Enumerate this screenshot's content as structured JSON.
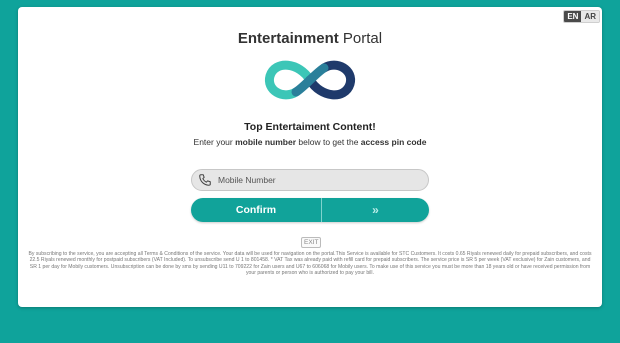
{
  "lang": {
    "en": "EN",
    "ar": "AR"
  },
  "header": {
    "title_bold": "Entertainment",
    "title_rest": " Portal"
  },
  "hero": {
    "headline": "Top Entertaiment Content!",
    "sub_prefix": "Enter your ",
    "sub_bold1": "mobile number",
    "sub_mid": " below to get the ",
    "sub_bold2": "access pin code"
  },
  "form": {
    "mobile_placeholder": "Mobile Number",
    "confirm_label": "Confirm",
    "next_label": "»",
    "exit_label": "EXIT"
  },
  "terms": "By subscribing to the service, you are accepting all Terms & Conditions of the service. Your data will be used for navigation on the portal.This Service is available for STC Customers. It costs 0.65 Riyals renewed daily for prepaid subscribers, and costs 22.5 Riyals renewed monthly for postpaid subscribers (VAT Included). To unsubscribe send U 1 to 801458. * VAT Tax was already paid with refill card for prepaid subscribers. The service price is SR 5 per week (VAT exclusive) for Zain customers, and SR 1 per day for Mobily customers. Unsubscription can be done by sms by sending U11 to 709222 for Zain users and U67 to 606068 for Mobily users. To make use of this service you must be more than 18 years old or have received permission from your parents or person who is authorized to pay your bill.",
  "colors": {
    "background": "#0fa39b",
    "button": "#11a39a",
    "logo_dark": "#1f3a6b",
    "logo_light": "#3cc6b7"
  },
  "icons": {
    "phone": "phone-icon",
    "logo": "infinity-logo"
  }
}
